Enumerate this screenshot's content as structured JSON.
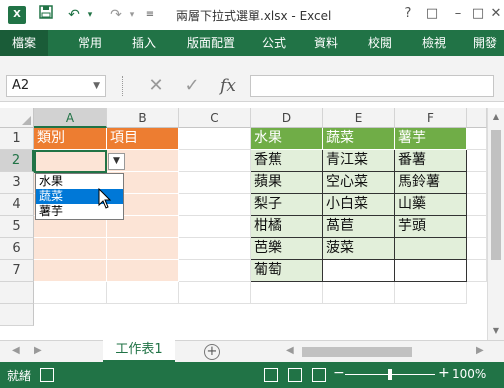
{
  "titlebar": {
    "app_icon": "X",
    "title": "兩層下拉式選單.xlsx - Excel",
    "quick_access": [
      "save-icon",
      "undo-icon",
      "redo-icon",
      "customize-icon"
    ],
    "window_buttons": [
      "?",
      "□",
      "–",
      "□",
      "✕"
    ]
  },
  "ribbon": {
    "tabs": [
      "檔案",
      "常用",
      "插入",
      "版面配置",
      "公式",
      "資料",
      "校閱",
      "檢視",
      "開發"
    ]
  },
  "formula_bar": {
    "name_box": "A2",
    "cancel_icon": "✕",
    "enter_icon": "✓",
    "fx_label": "fx",
    "formula": ""
  },
  "grid": {
    "columns": [
      "A",
      "B",
      "C",
      "D",
      "E",
      "F"
    ],
    "rows": [
      "1",
      "2",
      "3",
      "4",
      "5",
      "6",
      "7"
    ],
    "A1": "類別",
    "B1": "項目",
    "D1": "水果",
    "E1": "蔬菜",
    "F1": "薯芋",
    "D": [
      "香蕉",
      "蘋果",
      "梨子",
      "柑橘",
      "芭樂",
      "葡萄"
    ],
    "E": [
      "青江菜",
      "空心菜",
      "小白菜",
      "萵苣",
      "菠菜",
      ""
    ],
    "F": [
      "番薯",
      "馬鈴薯",
      "山藥",
      "芋頭",
      "",
      ""
    ]
  },
  "dropdown": {
    "items": [
      "水果",
      "蔬菜",
      "薯芋"
    ],
    "highlighted": "蔬菜"
  },
  "sheet_tabs": {
    "active": "工作表1",
    "add_icon": "+"
  },
  "status_bar": {
    "status": "就緒",
    "zoom": "100%",
    "zoom_minus": "−",
    "zoom_plus": "+"
  },
  "colors": {
    "excel_green": "#217346",
    "orange_header": "#ed7d31",
    "peach": "#fce4d6",
    "green_header": "#70ad47",
    "light_green": "#e2efda",
    "selection_blue": "#0078d7"
  }
}
